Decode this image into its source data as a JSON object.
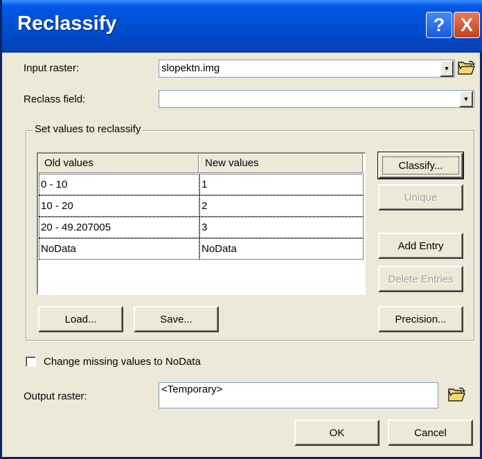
{
  "window": {
    "title": "Reclassify",
    "help_label": "?",
    "close_label": "X"
  },
  "input_raster": {
    "label": "Input raster:",
    "value": "slopektn.img"
  },
  "reclass_field": {
    "label": "Reclass field:",
    "value": ""
  },
  "reclass_group": {
    "title": "Set values to reclassify",
    "columns": [
      "Old values",
      "New values"
    ],
    "rows": [
      {
        "old": "0 - 10",
        "new": "1"
      },
      {
        "old": "10 - 20",
        "new": "2"
      },
      {
        "old": "20 - 49.207005",
        "new": "3"
      },
      {
        "old": "NoData",
        "new": "NoData"
      }
    ],
    "buttons": {
      "classify": "Classify...",
      "unique": "Unique",
      "add_entry": "Add Entry",
      "delete_entries": "Delete Entries",
      "load": "Load...",
      "save": "Save...",
      "precision": "Precision..."
    }
  },
  "missing_values": {
    "label": "Change missing values to NoData",
    "checked": false
  },
  "output_raster": {
    "label": "Output raster:",
    "value": "<Temporary>"
  },
  "footer": {
    "ok": "OK",
    "cancel": "Cancel"
  },
  "icons": {
    "browse": "open-folder-icon",
    "dropdown": "chevron-down-icon"
  }
}
